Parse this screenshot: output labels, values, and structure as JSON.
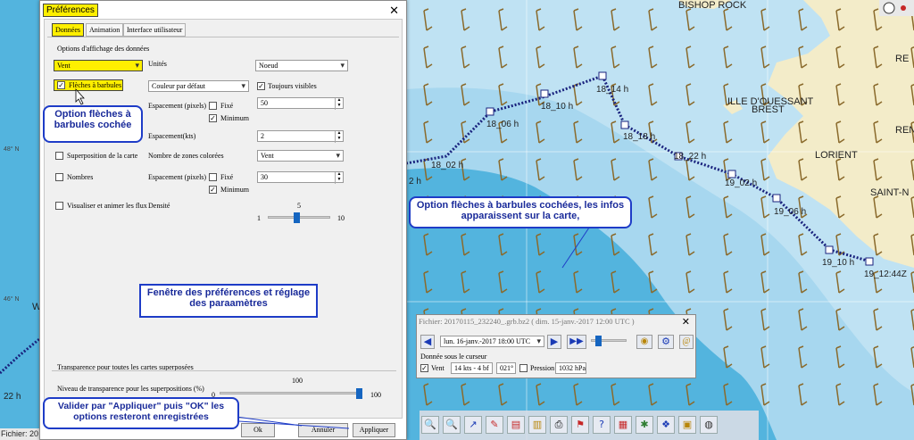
{
  "map": {
    "places": [
      "BISHOP ROCK",
      "ILLE D'OUESSANT",
      "BREST",
      "LORIENT",
      "SAINT-N",
      "REN",
      "RE"
    ],
    "lat_labels": [
      "48° N",
      "46° N"
    ],
    "route_points": [
      "18_02 h",
      "18_06 h",
      "18_10 h",
      "18_14 h",
      "18_18 h",
      "18_22 h",
      "19_02 h",
      "19_06 h",
      "19_10 h",
      "19_12:44Z"
    ],
    "left_marks": [
      "2 h",
      "W",
      "22 h"
    ],
    "status": "Fichier: 20"
  },
  "prefs": {
    "title": "Préférences",
    "tabs": [
      "Données",
      "Animation",
      "Interface utilisateur"
    ],
    "group_title": "Options d'affichage des données",
    "data_select": "Vent",
    "units_label": "Unités",
    "units_value": "Noeud",
    "barbs_label": "Flèches à barbules",
    "color_value": "Couleur par défaut",
    "always_visible": "Toujours visibles",
    "spacing_label": "Espacement (pixels)",
    "fixed_label": "Fixé",
    "minimum_label": "Minimum",
    "spacing_value": "50",
    "spacing_kts_label": "Espacement(kts)",
    "spacing_kts_value": "2",
    "superposition_label": "Superposition de la carte",
    "zones_label": "Nombre de zones colorées",
    "zones_value": "Vent",
    "numbers_label": "Nombres",
    "spacing2_value": "30",
    "visualize_label": "Visualiser et animer les flux",
    "density_label": "Densité",
    "density_min": "1",
    "density_max": "10",
    "density_value": "5",
    "density_level": 0.44,
    "transparency_title": "Transparence pour toutes les cartes superposées",
    "transparency_label": "Niveau de transparence pour les superpositions (%)",
    "transparency_min": "0",
    "transparency_max": "100",
    "transparency_value": "100",
    "ok": "Ok",
    "cancel": "Annuler",
    "apply": "Appliquer"
  },
  "callouts": {
    "barbs_checked": "Option flèches à barbules cochée",
    "map_info": "Option flèches à barbules cochées, les infos apparaissent sur la carte,",
    "pref_window": "Fenêtre des préférences et réglage des paraamètres",
    "validate": "Valider par \"Appliquer\" puis \"OK\" les options resteront enregistrées"
  },
  "file_window": {
    "title": "Fichier: 20170115_232240_.grb.bz2 ( dim. 15-janv.-2017 12:00  UTC )",
    "date_select": "lun. 16-janv.-2017 18:00  UTC",
    "cursor_title": "Donnée sous le curseur",
    "wind_label": "Vent",
    "wind_value": "14 kts - 4 bf",
    "direction": "021°",
    "pressure_label": "Pression",
    "pressure_value": "1032 hPa"
  },
  "toolbar_icons": [
    "zoom-in-icon",
    "zoom-out-icon",
    "route-icon",
    "pencil-icon",
    "table-icon",
    "print-icon",
    "flag-icon",
    "help-icon",
    "grid-icon",
    "map-icon",
    "palette-icon",
    "layers-icon",
    "image-icon",
    "globe-icon"
  ],
  "colors": {
    "sea_deep": "#53b4de",
    "sea_light": "#a7d7ef",
    "land": "#f3ecc9",
    "arrow": "#8a6a2c",
    "route": "#1a237e",
    "callout_border": "#1e3cc7",
    "highlight": "#ffef00"
  }
}
